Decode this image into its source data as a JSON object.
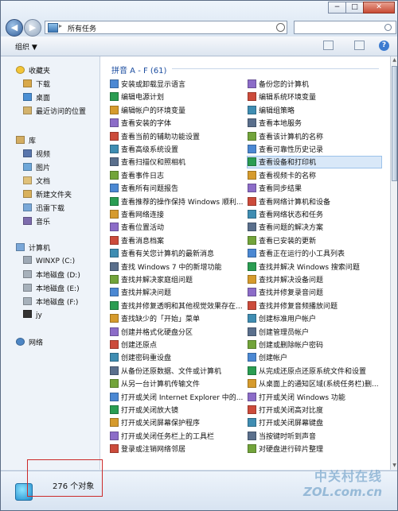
{
  "window": {
    "address": "所有任务",
    "organize": "组织 ▼",
    "controls": [
      "−",
      "□",
      "✕"
    ]
  },
  "sidebar": {
    "favorites": "收藏夹",
    "favorites_items": [
      "下载",
      "桌面",
      "最近访问的位置"
    ],
    "library": "库",
    "library_items": [
      "视频",
      "图片",
      "文档",
      "新建文件夹",
      "迅雷下载",
      "音乐"
    ],
    "computer": "计算机",
    "computer_items": [
      "WINXP (C:)",
      "本地磁盘 (D:)",
      "本地磁盘 (E:)",
      "本地磁盘 (F:)",
      "jy"
    ],
    "network": "网络"
  },
  "content": {
    "group_header": "拼音 A - F (61)",
    "tasks_left": [
      "安装或卸载显示语言",
      "编辑电源计划",
      "编辑帐户的环境变量",
      "查看安装的字体",
      "查看当前的辅助功能设置",
      "查看高级系统设置",
      "查看扫描仪和照相机",
      "查看事件日志",
      "查看所有问题报告",
      "查看推荐的操作保持 Windows 顺利...",
      "查看网络连接",
      "查看位置活动",
      "查看消息档案",
      "查看有关您计算机的最新消息",
      "查找 Windows 7 中的新增功能",
      "查找并解决家庭组问题",
      "查找并解决问题",
      "查找并修复透明和其他视觉效果存在...",
      "查找缺少的「开始」菜单",
      "创建并格式化硬盘分区",
      "创建还原点",
      "创建密码重设盘",
      "从备份还原数据、文件或计算机",
      "从另一台计算机传输文件",
      "打开或关闭 Internet Explorer 中的...",
      "打开或关闭放大镜",
      "打开或关闭屏幕保护程序",
      "打开或关闭任务栏上的工具栏",
      "登录或注销网络邻居"
    ],
    "tasks_right": [
      "备份您的计算机",
      "编辑系统环境变量",
      "编辑组策略",
      "查看本地服务",
      "查看该计算机的名称",
      "查看可靠性历史记录",
      "查看设备和打印机",
      "查看视频卡的名称",
      "查看同步结果",
      "查看网络计算机和设备",
      "查看网络状态和任务",
      "查看问题的解决方案",
      "查看已安装的更新",
      "查看正在运行的小工具列表",
      "查找并解决 Windows 搜索问题",
      "查找并解决设备问题",
      "查找并修复录音问题",
      "查找并修复音频播放问题",
      "创建标准用户帐户",
      "创建管理员帐户",
      "创建或删除帐户密码",
      "创建帐户",
      "从完成还原点还原系统文件和设置",
      "从桌面上的通知区域(系统任务栏)删...",
      "打开或关闭 Windows 功能",
      "打开或关闭高对比度",
      "打开或关闭屏幕键盘",
      "当按键时听到声音",
      "对硬盘进行碎片整理"
    ],
    "selected_task": "查看设备和打印机"
  },
  "status": {
    "count": "276 个对象"
  },
  "watermark": {
    "line1": "中关村在线",
    "line2": "ZOL.com.cn"
  }
}
